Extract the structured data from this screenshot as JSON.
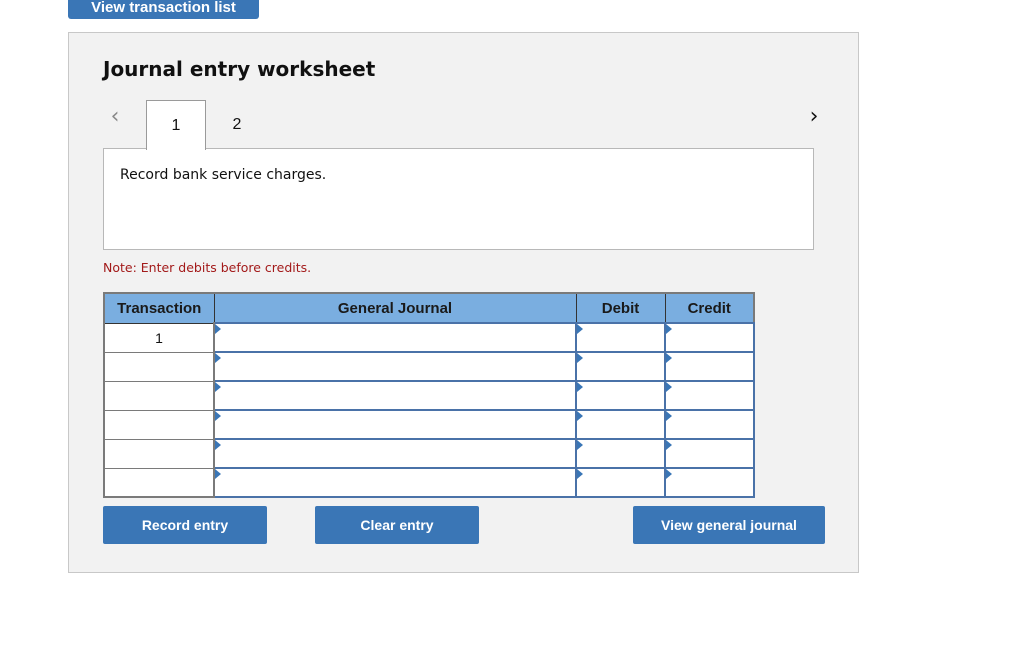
{
  "top_button": {
    "label": "View transaction list"
  },
  "worksheet": {
    "title": "Journal entry worksheet",
    "nav": {
      "prev_icon": "chevron-left-icon",
      "next_icon": "chevron-right-icon"
    },
    "tabs": [
      {
        "label": "1",
        "active": true
      },
      {
        "label": "2",
        "active": false
      }
    ],
    "description": "Record bank service charges.",
    "note": "Note: Enter debits before credits.",
    "table": {
      "headers": [
        "Transaction",
        "General Journal",
        "Debit",
        "Credit"
      ],
      "rows": [
        {
          "transaction": "1",
          "account": "",
          "debit": "",
          "credit": ""
        },
        {
          "transaction": "",
          "account": "",
          "debit": "",
          "credit": ""
        },
        {
          "transaction": "",
          "account": "",
          "debit": "",
          "credit": ""
        },
        {
          "transaction": "",
          "account": "",
          "debit": "",
          "credit": ""
        },
        {
          "transaction": "",
          "account": "",
          "debit": "",
          "credit": ""
        },
        {
          "transaction": "",
          "account": "",
          "debit": "",
          "credit": ""
        }
      ]
    },
    "buttons": {
      "record": "Record entry",
      "clear": "Clear entry",
      "view_journal": "View general journal"
    }
  },
  "colors": {
    "button_blue": "#3a76b6",
    "header_blue": "#7aaee0",
    "note_red": "#a31a1a",
    "panel_bg": "#f2f2f2"
  }
}
